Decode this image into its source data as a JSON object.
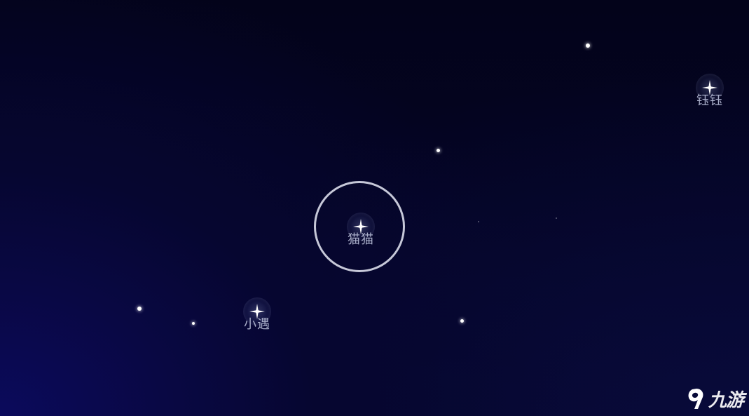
{
  "friends": [
    {
      "name": "猫猫",
      "selected": true
    },
    {
      "name": "小遇",
      "selected": false
    },
    {
      "name": "钰钰",
      "selected": false
    }
  ],
  "watermark": {
    "text": "九游",
    "icon": "jiuyou-logo-icon"
  },
  "colors": {
    "sky_dark": "#03031a",
    "sky_glow": "#0b0a5c",
    "label": "#a9aec9",
    "ring": "#e1e4f0"
  }
}
